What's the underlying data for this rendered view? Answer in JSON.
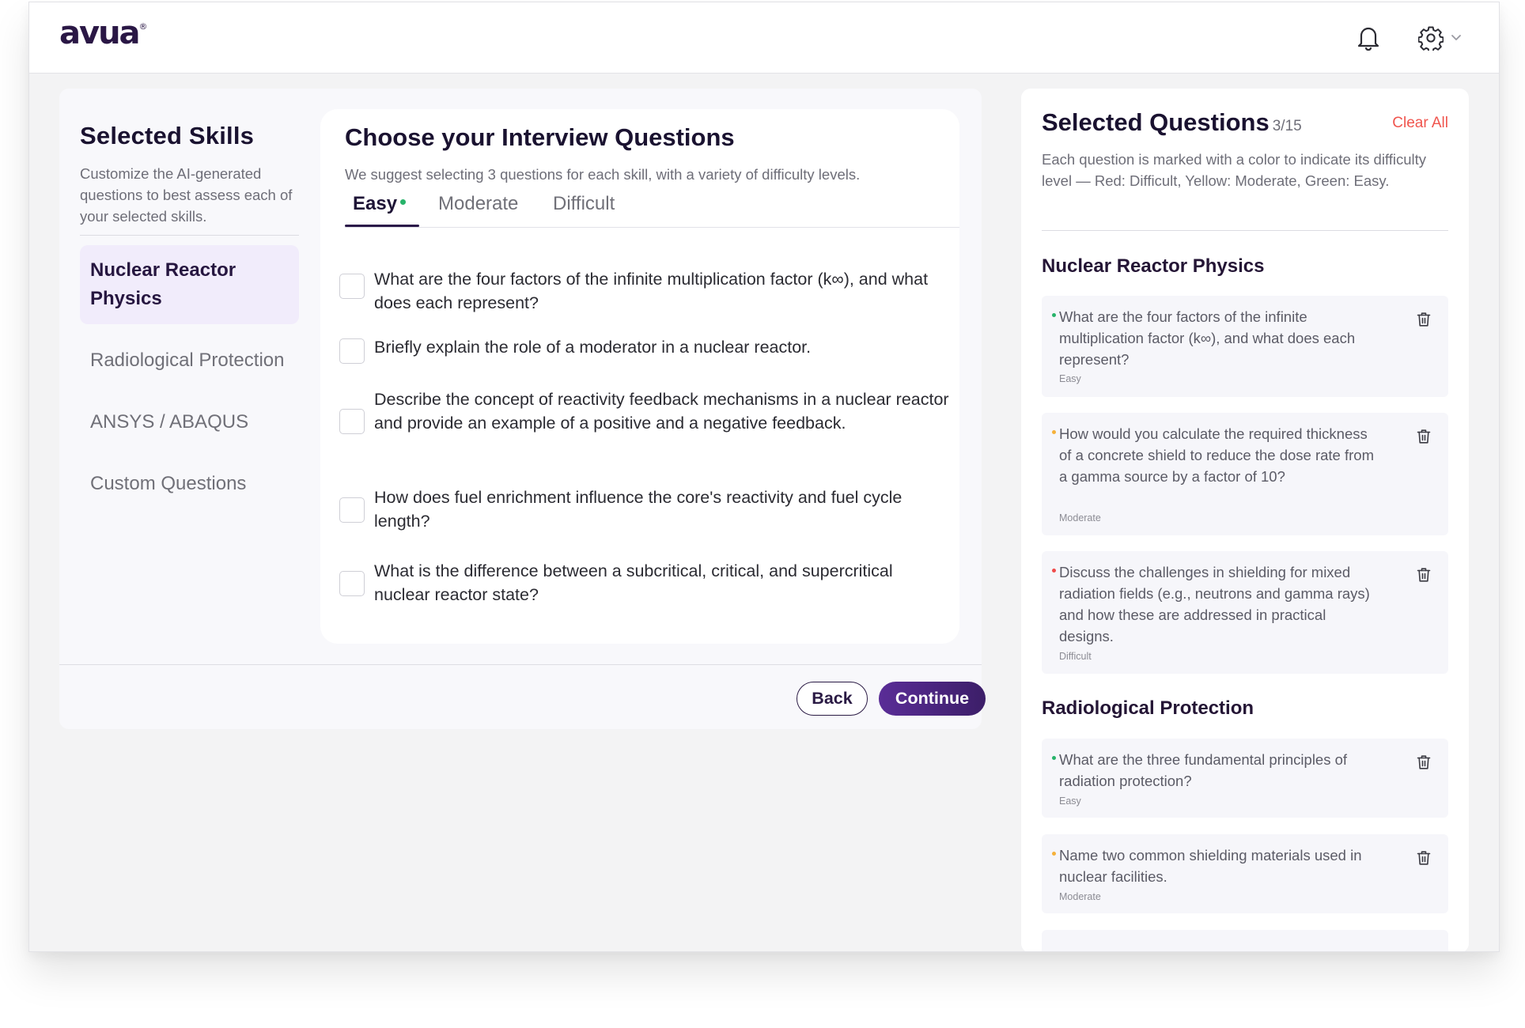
{
  "header": {
    "logo": "avua",
    "logo_reg": "®"
  },
  "skills": {
    "title": "Selected Skills",
    "description": "Customize the AI-generated questions to best assess each of your selected skills.",
    "items": [
      {
        "label": "Nuclear Reactor Physics",
        "active": true
      },
      {
        "label": "Radiological Protection",
        "active": false
      },
      {
        "label": "ANSYS / ABAQUS",
        "active": false
      },
      {
        "label": "Custom Questions",
        "active": false
      }
    ]
  },
  "questions": {
    "title": "Choose your Interview Questions",
    "subtitle": "We suggest selecting 3 questions for each skill, with a variety of difficulty levels.",
    "tabs": [
      {
        "label": "Easy",
        "active": true
      },
      {
        "label": "Moderate",
        "active": false
      },
      {
        "label": "Difficult",
        "active": false
      }
    ],
    "items": [
      {
        "text": "What are the four factors of the infinite multiplication factor (k∞), and what does each represent?",
        "checked": false
      },
      {
        "text": "Briefly explain the role of a moderator in a nuclear reactor.",
        "checked": false
      },
      {
        "text": "Describe the concept of reactivity feedback mechanisms in a nuclear reactor and provide an example of a positive and a negative feedback.",
        "checked": false
      },
      {
        "text": "How does fuel enrichment influence the core's reactivity and fuel cycle length?",
        "checked": false
      },
      {
        "text": "What is the difference between a subcritical, critical, and supercritical nuclear reactor state?",
        "checked": false
      }
    ]
  },
  "actions": {
    "back": "Back",
    "continue": "Continue"
  },
  "selected": {
    "title": "Selected Questions",
    "count": "3/15",
    "clear_all": "Clear All",
    "description": "Each question is marked with a color to indicate its difficulty level — Red: Difficult, Yellow: Moderate, Green: Easy.",
    "level_colors": {
      "Easy": "#27b36a",
      "Moderate": "#f5b13a",
      "Difficult": "#ef4b4b"
    },
    "sections": [
      {
        "title": "Nuclear Reactor Physics",
        "questions": [
          {
            "text": "What are the four factors of the infinite multiplication factor (k∞), and what does each represent?",
            "level": "Easy"
          },
          {
            "text": "How would you calculate the required thickness of a concrete shield to reduce the dose rate from a gamma source by a factor of 10?",
            "level": "Moderate"
          },
          {
            "text": "Discuss the challenges in shielding for mixed radiation fields (e.g., neutrons and gamma rays) and how these are addressed in practical designs.",
            "level": "Difficult"
          }
        ]
      },
      {
        "title": "Radiological Protection",
        "questions": [
          {
            "text": "What are the three fundamental principles of radiation protection?",
            "level": "Easy"
          },
          {
            "text": "Name two common shielding materials used in nuclear facilities.",
            "level": "Moderate"
          }
        ]
      }
    ]
  }
}
